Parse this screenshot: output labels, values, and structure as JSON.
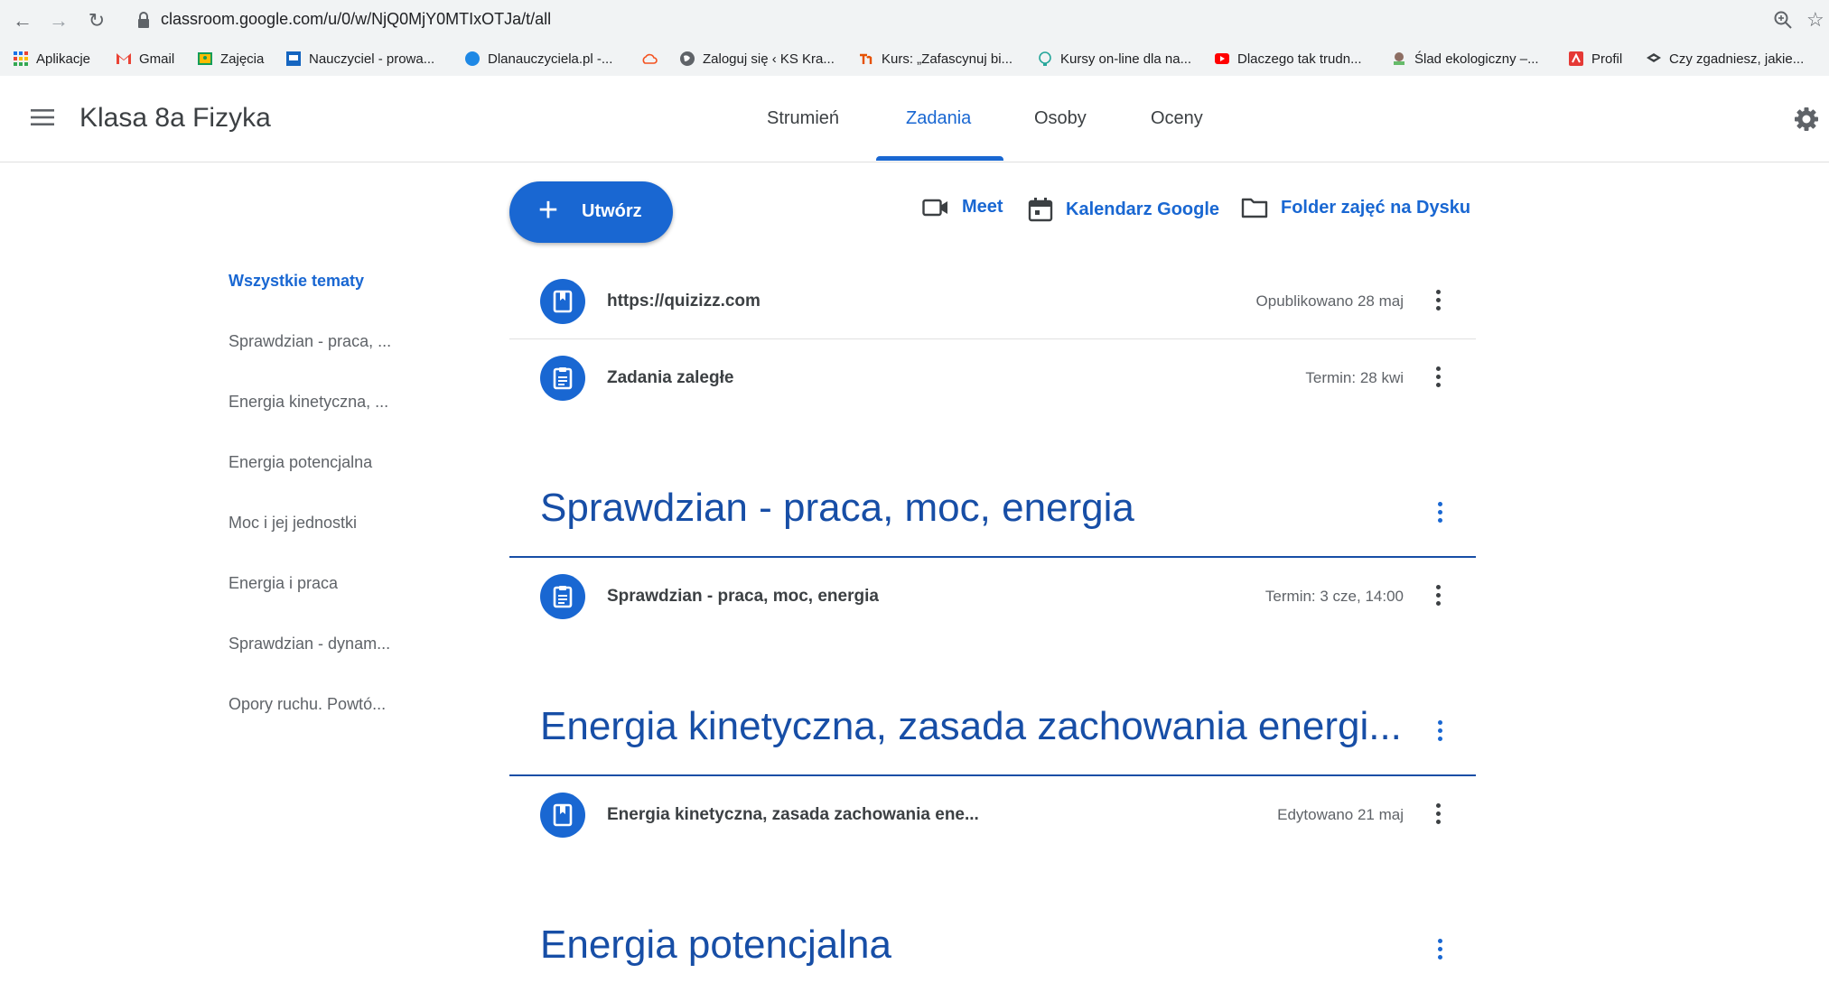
{
  "browser": {
    "url": "classroom.google.com/u/0/w/NjQ0MjY0MTIxOTJa/t/all",
    "bookmarks": [
      {
        "label": "Aplikacje",
        "icon": "apps-grid-icon"
      },
      {
        "label": "Gmail",
        "icon": "gmail-icon"
      },
      {
        "label": "Zajęcia",
        "icon": "classroom-icon"
      },
      {
        "label": "Nauczyciel - prowa...",
        "icon": "teacher-site-icon"
      },
      {
        "label": "Dlanauczyciela.pl -...",
        "icon": "blue-circle-icon"
      },
      {
        "label": "",
        "icon": "cloud-icon"
      },
      {
        "label": "Zaloguj się ‹ KS Kra...",
        "icon": "globe-icon"
      },
      {
        "label": "Kurs: „Zafascynuj bi...",
        "icon": "course-icon"
      },
      {
        "label": "Kursy on-line dla na...",
        "icon": "bulb-icon"
      },
      {
        "label": "Dlaczego tak trudn...",
        "icon": "youtube-icon"
      },
      {
        "label": "Ślad ekologiczny –...",
        "icon": "eco-icon"
      },
      {
        "label": "Profil",
        "icon": "profile-icon"
      },
      {
        "label": "Czy zgadniesz, jakie...",
        "icon": "layers-icon"
      }
    ]
  },
  "header": {
    "class_title": "Klasa 8a Fizyka",
    "tabs": [
      "Strumień",
      "Zadania",
      "Osoby",
      "Oceny"
    ],
    "active_tab": "Zadania"
  },
  "actions": {
    "create_label": "Utwórz",
    "meet_label": "Meet",
    "calendar_label": "Kalendarz Google",
    "drive_label": "Folder zajęć na Dysku"
  },
  "topics": [
    "Wszystkie tematy",
    "Sprawdzian - praca, ...",
    "Energia kinetyczna, ...",
    "Energia potencjalna",
    "Moc i jej jednostki",
    "Energia i praca",
    "Sprawdzian - dynam...",
    "Opory ruchu. Powtó..."
  ],
  "stream": {
    "items_top": [
      {
        "title": "https://quizizz.com",
        "meta": "Opublikowano 28 maj",
        "icon": "material-icon"
      },
      {
        "title": "Zadania zaległe",
        "meta": "Termin: 28 kwi",
        "icon": "assignment-icon"
      }
    ],
    "sections": [
      {
        "title": "Sprawdzian - praca, moc, energia",
        "item": {
          "title": "Sprawdzian - praca, moc, energia",
          "meta": "Termin: 3 cze, 14:00",
          "icon": "assignment-icon"
        }
      },
      {
        "title": "Energia kinetyczna, zasada zachowania energi...",
        "item": {
          "title": "Energia kinetyczna, zasada zachowania ene...",
          "meta": "Edytowano 21 maj",
          "icon": "material-icon"
        }
      },
      {
        "title": "Energia potencjalna"
      }
    ]
  },
  "colors": {
    "accent": "#1967d2",
    "section_title": "#174ea6"
  }
}
